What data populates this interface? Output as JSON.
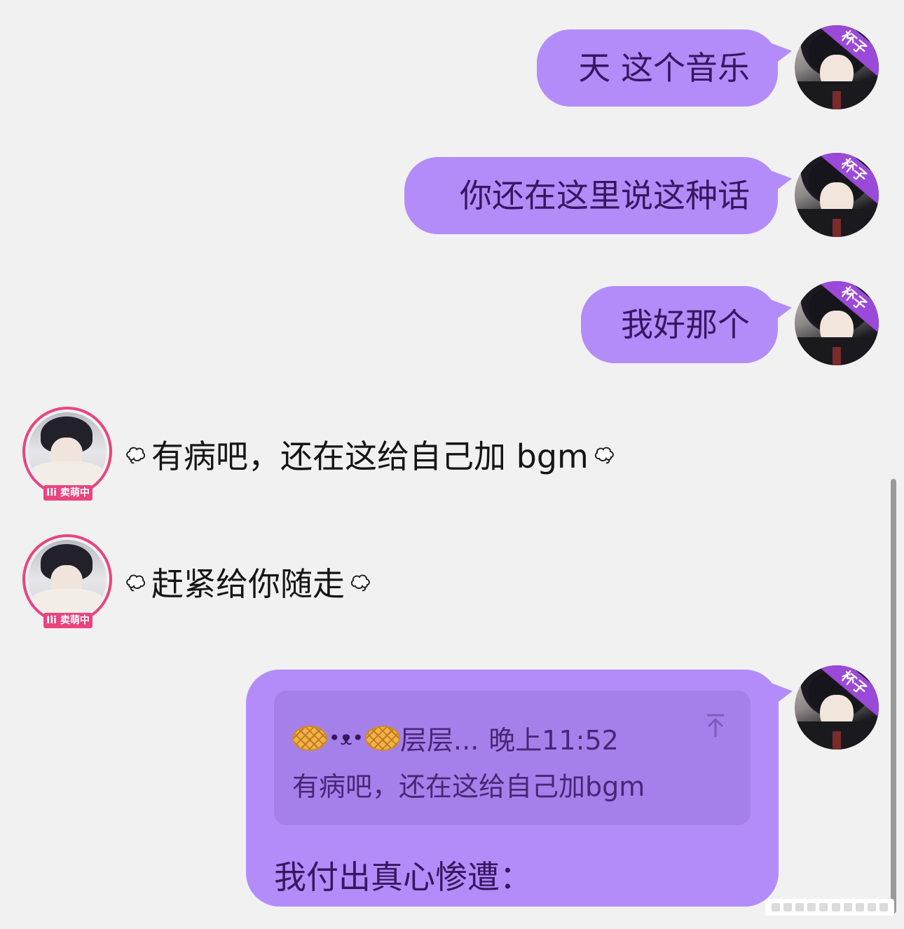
{
  "self": {
    "badge_label": "杯子"
  },
  "other": {
    "tag_label": "卖萌中"
  },
  "messages": [
    {
      "text": "天 这个音乐"
    },
    {
      "text": "你还在这里说这种话"
    },
    {
      "text": "我好那个"
    },
    {
      "text": "有病吧，还在这给自己加 bgm"
    },
    {
      "text": "赶紧给你随走"
    }
  ],
  "reply": {
    "quoted_sender": "层层...",
    "quoted_kaomoji": "•ᴥ•",
    "quoted_time": "晚上11:52",
    "quoted_text": "有病吧，还在这给自己加bgm",
    "text": "我付出真心惨遭："
  },
  "colors": {
    "self_bubble": "#b38cf9",
    "quote_block": "#a680ea",
    "other_ring": "#e8457f",
    "self_badge": "#9b49d8",
    "background": "#f1f1f2"
  },
  "icons": {
    "left_puff": "puff-cloud-left-icon",
    "right_puff": "puff-cloud-right-icon",
    "collapse": "collapse-up-icon"
  }
}
